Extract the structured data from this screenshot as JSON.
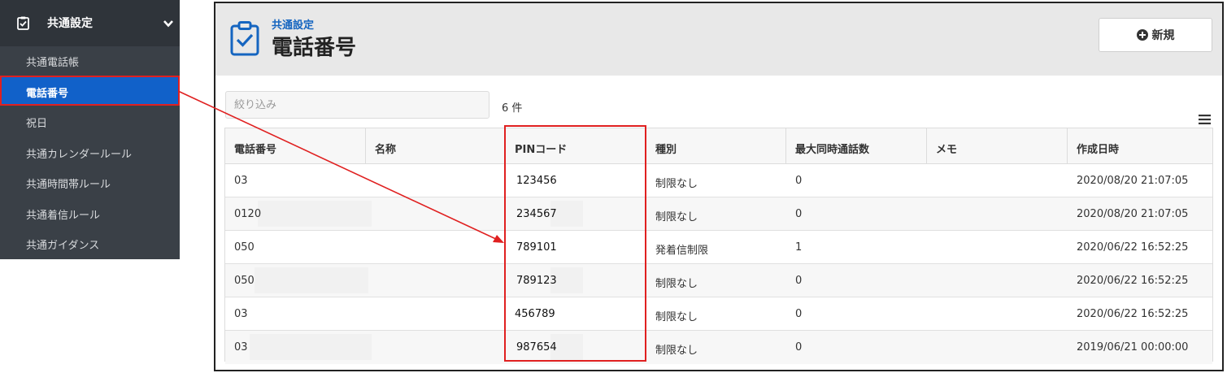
{
  "sidebar": {
    "section_label": "共通設定",
    "items": [
      {
        "label": "共通電話帳"
      },
      {
        "label": "電話番号"
      },
      {
        "label": "祝日"
      },
      {
        "label": "共通カレンダールール"
      },
      {
        "label": "共通時間帯ルール"
      },
      {
        "label": "共通着信ルール"
      },
      {
        "label": "共通ガイダンス"
      }
    ],
    "active_item": "電話番号"
  },
  "header": {
    "breadcrumb": "共通設定",
    "title": "電話番号",
    "new_button_label": "新規"
  },
  "toolbar": {
    "filter_placeholder": "絞り込み",
    "count_text": "6 件"
  },
  "table": {
    "columns": [
      "電話番号",
      "名称",
      "PINコード",
      "種別",
      "最大同時通話数",
      "メモ",
      "作成日時"
    ],
    "rows": [
      {
        "phone": "03",
        "name": "",
        "pin": "123456",
        "type": "制限なし",
        "max_calls": "0",
        "memo": "",
        "created": "2020/08/20 21:07:05"
      },
      {
        "phone": "0120",
        "name": "",
        "pin": "234567",
        "type": "制限なし",
        "max_calls": "0",
        "memo": "",
        "created": "2020/08/20 21:07:05"
      },
      {
        "phone": "050",
        "name": "",
        "pin": "789101",
        "type": "発着信制限",
        "max_calls": "1",
        "memo": "",
        "created": "2020/06/22 16:52:25"
      },
      {
        "phone": "050",
        "name": "",
        "pin": "789123",
        "type": "制限なし",
        "max_calls": "0",
        "memo": "",
        "created": "2020/06/22 16:52:25"
      },
      {
        "phone": "03",
        "name": "",
        "pin": "456789",
        "type": "制限なし",
        "max_calls": "0",
        "memo": "",
        "created": "2020/06/22 16:52:25"
      },
      {
        "phone": "03",
        "name": "",
        "pin": "987654",
        "type": "制限なし",
        "max_calls": "0",
        "memo": "",
        "created": "2019/06/21 00:00:00"
      }
    ]
  },
  "colors": {
    "sidebar_bg": "#3a4047",
    "sidebar_header_bg": "#2f343a",
    "active_item_bg": "#1161c9",
    "accent_blue": "#1565c0",
    "annotation_red": "#e02020"
  },
  "icons": {
    "sidebar_section": "clipboard-check-icon",
    "chevron": "chevron-down-icon",
    "title": "clipboard-check-icon",
    "new_button": "plus-circle-icon",
    "column_menu": "hamburger-menu-icon"
  }
}
